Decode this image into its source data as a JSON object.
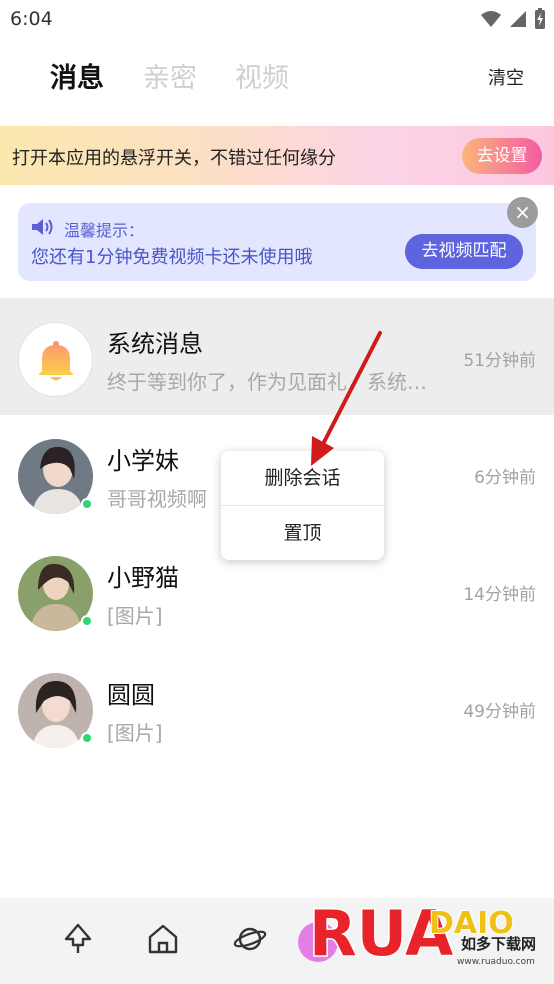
{
  "status_bar": {
    "time": "6:04"
  },
  "tabs": {
    "active": "消息",
    "tab2": "亲密",
    "tab3": "视频",
    "clear": "清空"
  },
  "float_banner": {
    "text": "打开本应用的悬浮开关，不错过任何缘分",
    "button": "去设置"
  },
  "tip": {
    "title": "温馨提示：",
    "body": "您还有1分钟免费视频卡还未使用哦",
    "button": "去视频匹配",
    "close": "×"
  },
  "messages": [
    {
      "name": "系统消息",
      "preview": "终于等到你了，作为见面礼，系统…",
      "time": "51分钟前"
    },
    {
      "name": "小学妹",
      "preview": "哥哥视频啊",
      "time": "6分钟前"
    },
    {
      "name": "小野猫",
      "preview": "[图片]",
      "time": "14分钟前"
    },
    {
      "name": "圆圆",
      "preview": "[图片]",
      "time": "49分钟前"
    }
  ],
  "context_menu": {
    "delete": "删除会话",
    "pin": "置顶"
  },
  "watermark": {
    "logo": "RUANDAIO",
    "cn": "如多下载网",
    "url": "www.ruaduo.com"
  },
  "colors": {
    "accent": "#5e63de",
    "online": "#2fd673",
    "banner_btn_from": "#fbb57a",
    "banner_btn_to": "#f45ca3",
    "arrow": "#d11a1a"
  }
}
